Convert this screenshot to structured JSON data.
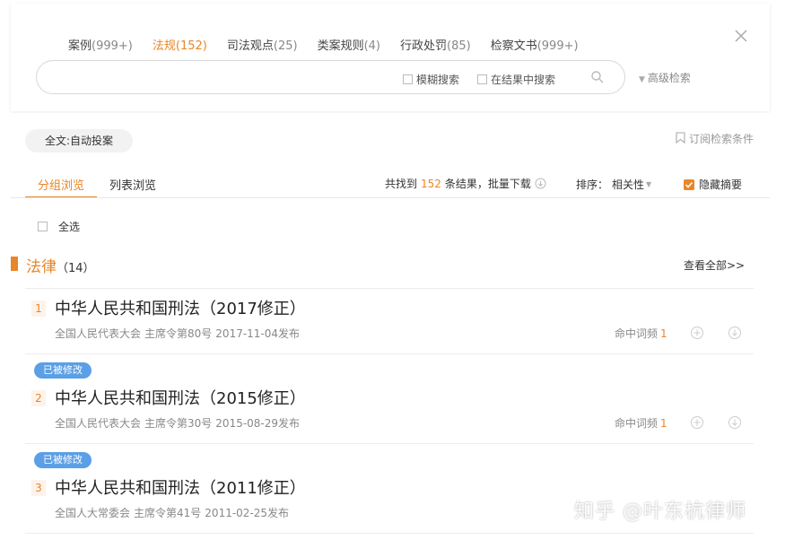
{
  "tabs": [
    {
      "label": "案例",
      "count": "(999+)"
    },
    {
      "label": "法规",
      "count": "(152)"
    },
    {
      "label": "司法观点",
      "count": "(25)"
    },
    {
      "label": "类案规则",
      "count": "(4)"
    },
    {
      "label": "行政处罚",
      "count": "(85)"
    },
    {
      "label": "检察文书",
      "count": "(999+)"
    }
  ],
  "search": {
    "value": "",
    "placeholder": "",
    "fuzzy_label": "模糊搜索",
    "within_label": "在结果中搜索"
  },
  "advanced_label": "高级检索",
  "filter_pill": "全文:自动投案",
  "subscribe_label": "订阅检索条件",
  "view_tabs": [
    "分组浏览",
    "列表浏览"
  ],
  "results": {
    "prefix": "共找到",
    "count": "152",
    "suffix": "条结果，批量下载"
  },
  "sort": {
    "label": "排序：",
    "value": "相关性"
  },
  "hide_summary_label": "隐藏摘要",
  "select_all_label": "全选",
  "category": {
    "title": "法律",
    "count": "（14）",
    "view_all": "查看全部>>"
  },
  "hits_label": "命中词频",
  "items": [
    {
      "index": "1",
      "badge": "",
      "title": "中华人民共和国刑法（2017修正）",
      "issuer": "全国人民代表大会",
      "doc_no": "主席令第80号",
      "date": "2017-11-04发布",
      "hits": "1"
    },
    {
      "index": "2",
      "badge": "已被修改",
      "title": "中华人民共和国刑法（2015修正）",
      "issuer": "全国人民代表大会",
      "doc_no": "主席令第30号",
      "date": "2015-08-29发布",
      "hits": "1"
    },
    {
      "index": "3",
      "badge": "已被修改",
      "title": "中华人民共和国刑法（2011修正）",
      "issuer": "全国人大常委会",
      "doc_no": "主席令第41号",
      "date": "2011-02-25发布",
      "hits": ""
    }
  ],
  "watermark": "知乎 @叶东杭律师",
  "colors": {
    "accent": "#e8862a",
    "badge": "#5b9fe6"
  }
}
